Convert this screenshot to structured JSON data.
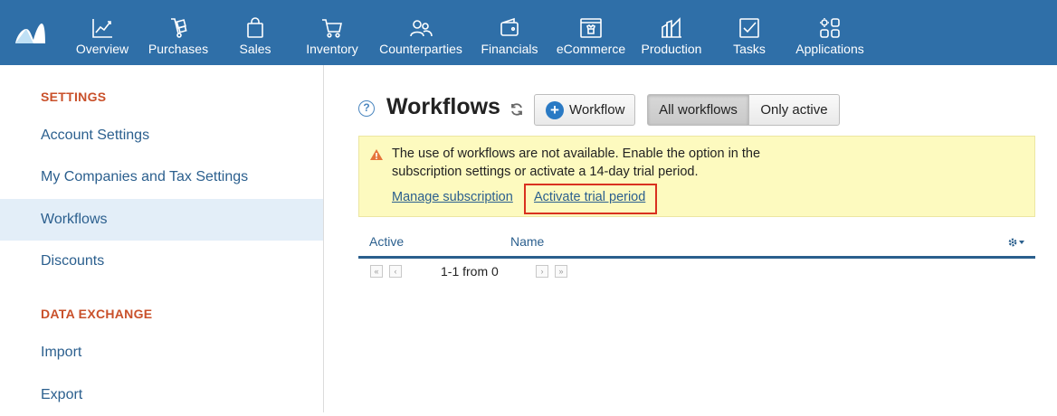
{
  "nav": {
    "items": [
      {
        "label": "Overview",
        "icon": "overview-chart-icon"
      },
      {
        "label": "Purchases",
        "icon": "purchases-dolly-icon"
      },
      {
        "label": "Sales",
        "icon": "sales-bag-icon"
      },
      {
        "label": "Inventory",
        "icon": "inventory-cart-icon"
      },
      {
        "label": "Counterparties",
        "icon": "counterparties-people-icon"
      },
      {
        "label": "Financials",
        "icon": "financials-wallet-icon"
      },
      {
        "label": "eCommerce",
        "icon": "ecommerce-store-icon"
      },
      {
        "label": "Production",
        "icon": "production-factory-icon"
      },
      {
        "label": "Tasks",
        "icon": "tasks-checkbox-icon"
      },
      {
        "label": "Applications",
        "icon": "applications-grid-icon"
      }
    ]
  },
  "sidebar": {
    "settings_heading": "SETTINGS",
    "settings_items": [
      {
        "label": "Account Settings"
      },
      {
        "label": "My Companies and Tax Settings"
      },
      {
        "label": "Workflows"
      },
      {
        "label": "Discounts"
      }
    ],
    "exchange_heading": "DATA EXCHANGE",
    "exchange_items": [
      {
        "label": "Import"
      },
      {
        "label": "Export"
      }
    ],
    "active_item": "Workflows"
  },
  "main": {
    "help_glyph": "?",
    "title": "Workflows",
    "add_button_label": "Workflow",
    "filter_all_label": "All workflows",
    "filter_active_label": "Only active",
    "alert": {
      "line1": "The use of workflows are not available. Enable the option in the",
      "line2": "subscription settings or activate a 14-day trial period.",
      "manage_link": "Manage subscription",
      "trial_link": "Activate trial period"
    },
    "table": {
      "col_active": "Active",
      "col_name": "Name"
    },
    "pager": {
      "text": "1-1 from 0",
      "first_glyph": "«",
      "prev_glyph": "‹",
      "next_glyph": "›",
      "last_glyph": "»"
    }
  },
  "colors": {
    "topbar": "#2f6fa8",
    "accent_heading": "#c9502a",
    "link": "#2b5f8e",
    "alert_bg": "#fdfabf",
    "highlight_border": "#d9311f"
  }
}
